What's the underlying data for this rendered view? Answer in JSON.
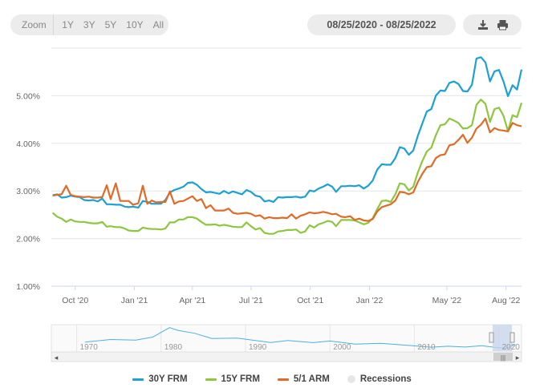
{
  "toolbar": {
    "zoom_label": "Zoom",
    "zoom_options": [
      "1Y",
      "3Y",
      "5Y",
      "10Y",
      "All"
    ],
    "date_range": "08/25/2020 - 08/25/2022",
    "download_icon": "download-icon",
    "print_icon": "print-icon"
  },
  "navigator": {
    "year_labels": [
      "1970",
      "1980",
      "1990",
      "2000",
      "2010",
      "2020"
    ]
  },
  "legend": {
    "items": [
      {
        "label": "30Y FRM",
        "color": "#1ba1d8",
        "type": "line"
      },
      {
        "label": "15Y FRM",
        "color": "#8dc63f",
        "type": "line"
      },
      {
        "label": "5/1 ARM",
        "color": "#e06b27",
        "type": "line"
      },
      {
        "label": "Recessions",
        "color": "#e6e6e6",
        "type": "dot"
      }
    ]
  },
  "chart_data": {
    "type": "line",
    "x_tick_labels": [
      "Oct '20",
      "Jan '21",
      "Apr '21",
      "Jul '21",
      "Oct '21",
      "Jan '22",
      "May '22",
      "Aug '22"
    ],
    "y_tick_labels": [
      "1.00%",
      "2.00%",
      "3.00%",
      "4.00%",
      "5.00%"
    ],
    "ylim": [
      1.0,
      6.0
    ],
    "x": [
      "2020-08-27",
      "2020-09-03",
      "2020-09-10",
      "2020-09-17",
      "2020-09-24",
      "2020-10-01",
      "2020-10-08",
      "2020-10-15",
      "2020-10-22",
      "2020-10-29",
      "2020-11-05",
      "2020-11-12",
      "2020-11-19",
      "2020-11-25",
      "2020-12-03",
      "2020-12-10",
      "2020-12-17",
      "2020-12-23",
      "2020-12-30",
      "2021-01-07",
      "2021-01-14",
      "2021-01-21",
      "2021-01-28",
      "2021-02-04",
      "2021-02-11",
      "2021-02-18",
      "2021-02-25",
      "2021-03-04",
      "2021-03-11",
      "2021-03-18",
      "2021-03-25",
      "2021-04-01",
      "2021-04-08",
      "2021-04-15",
      "2021-04-22",
      "2021-04-29",
      "2021-05-06",
      "2021-05-13",
      "2021-05-20",
      "2021-05-27",
      "2021-06-03",
      "2021-06-10",
      "2021-06-17",
      "2021-06-24",
      "2021-07-01",
      "2021-07-08",
      "2021-07-15",
      "2021-07-22",
      "2021-07-29",
      "2021-08-05",
      "2021-08-12",
      "2021-08-19",
      "2021-08-26",
      "2021-09-02",
      "2021-09-09",
      "2021-09-16",
      "2021-09-23",
      "2021-09-30",
      "2021-10-07",
      "2021-10-14",
      "2021-10-21",
      "2021-10-28",
      "2021-11-04",
      "2021-11-10",
      "2021-11-18",
      "2021-11-24",
      "2021-12-02",
      "2021-12-09",
      "2021-12-16",
      "2021-12-23",
      "2021-12-30",
      "2022-01-06",
      "2022-01-13",
      "2022-01-20",
      "2022-01-27",
      "2022-02-03",
      "2022-02-10",
      "2022-02-17",
      "2022-02-24",
      "2022-03-03",
      "2022-03-10",
      "2022-03-17",
      "2022-03-24",
      "2022-03-31",
      "2022-04-07",
      "2022-04-14",
      "2022-04-21",
      "2022-04-28",
      "2022-05-05",
      "2022-05-12",
      "2022-05-19",
      "2022-05-26",
      "2022-06-02",
      "2022-06-09",
      "2022-06-16",
      "2022-06-23",
      "2022-06-30",
      "2022-07-07",
      "2022-07-14",
      "2022-07-21",
      "2022-07-28",
      "2022-08-04",
      "2022-08-11",
      "2022-08-18",
      "2022-08-25"
    ],
    "series": [
      {
        "name": "30Y FRM",
        "color": "#1ba1d8",
        "values": [
          2.91,
          2.93,
          2.86,
          2.87,
          2.9,
          2.88,
          2.87,
          2.81,
          2.8,
          2.81,
          2.78,
          2.84,
          2.72,
          2.72,
          2.71,
          2.71,
          2.67,
          2.66,
          2.67,
          2.65,
          2.79,
          2.77,
          2.73,
          2.73,
          2.73,
          2.81,
          2.97,
          3.02,
          3.05,
          3.09,
          3.17,
          3.18,
          3.13,
          3.04,
          2.97,
          2.98,
          2.96,
          2.94,
          3.0,
          2.95,
          2.99,
          2.96,
          2.93,
          3.02,
          2.98,
          2.9,
          2.88,
          2.78,
          2.8,
          2.77,
          2.87,
          2.86,
          2.87,
          2.87,
          2.88,
          2.86,
          2.88,
          3.01,
          2.99,
          3.05,
          3.09,
          3.14,
          3.09,
          2.98,
          3.1,
          3.1,
          3.11,
          3.1,
          3.12,
          3.05,
          3.11,
          3.22,
          3.45,
          3.56,
          3.55,
          3.55,
          3.69,
          3.92,
          3.89,
          3.76,
          3.85,
          4.16,
          4.42,
          4.67,
          4.72,
          5.0,
          5.11,
          5.1,
          5.27,
          5.3,
          5.25,
          5.1,
          5.09,
          5.23,
          5.78,
          5.81,
          5.7,
          5.3,
          5.51,
          5.54,
          5.3,
          4.99,
          5.22,
          5.13,
          5.55
        ]
      },
      {
        "name": "15Y FRM",
        "color": "#8dc63f",
        "values": [
          2.54,
          2.46,
          2.42,
          2.35,
          2.4,
          2.36,
          2.35,
          2.35,
          2.33,
          2.32,
          2.32,
          2.35,
          2.25,
          2.26,
          2.24,
          2.24,
          2.21,
          2.17,
          2.16,
          2.16,
          2.23,
          2.21,
          2.2,
          2.2,
          2.19,
          2.21,
          2.34,
          2.34,
          2.4,
          2.4,
          2.45,
          2.45,
          2.42,
          2.35,
          2.29,
          2.29,
          2.3,
          2.27,
          2.29,
          2.27,
          2.25,
          2.24,
          2.24,
          2.34,
          2.26,
          2.19,
          2.22,
          2.12,
          2.1,
          2.1,
          2.15,
          2.16,
          2.18,
          2.18,
          2.19,
          2.12,
          2.15,
          2.28,
          2.23,
          2.3,
          2.33,
          2.37,
          2.35,
          2.26,
          2.39,
          2.39,
          2.39,
          2.38,
          2.34,
          2.3,
          2.33,
          2.43,
          2.62,
          2.79,
          2.8,
          2.77,
          2.93,
          3.16,
          3.14,
          3.01,
          3.09,
          3.39,
          3.63,
          3.83,
          3.91,
          4.17,
          4.38,
          4.4,
          4.52,
          4.48,
          4.43,
          4.31,
          4.32,
          4.38,
          4.81,
          4.92,
          4.83,
          4.45,
          4.72,
          4.75,
          4.58,
          4.26,
          4.59,
          4.55,
          4.85
        ]
      },
      {
        "name": "5/1 ARM",
        "color": "#e06b27",
        "values": [
          2.9,
          2.92,
          2.93,
          3.11,
          2.92,
          2.89,
          2.88,
          2.87,
          2.88,
          2.86,
          2.86,
          2.87,
          3.12,
          2.83,
          3.16,
          2.79,
          2.79,
          2.79,
          2.71,
          2.74,
          3.11,
          2.73,
          2.8,
          2.76,
          2.77,
          2.77,
          2.99,
          2.73,
          2.78,
          2.79,
          2.84,
          2.89,
          2.79,
          2.83,
          2.64,
          2.7,
          2.59,
          2.59,
          2.59,
          2.63,
          2.54,
          2.52,
          2.53,
          2.54,
          2.52,
          2.47,
          2.49,
          2.42,
          2.45,
          2.43,
          2.43,
          2.44,
          2.43,
          2.51,
          2.42,
          2.48,
          2.51,
          2.55,
          2.53,
          2.54,
          2.56,
          2.54,
          2.51,
          2.52,
          2.46,
          2.45,
          2.47,
          2.39,
          2.42,
          2.38,
          2.37,
          2.41,
          2.57,
          2.66,
          2.69,
          2.72,
          2.8,
          2.98,
          2.97,
          2.93,
          2.97,
          3.19,
          3.36,
          3.5,
          3.52,
          3.69,
          3.75,
          3.77,
          3.96,
          3.98,
          4.07,
          4.18,
          4.01,
          4.12,
          4.31,
          4.39,
          4.52,
          4.23,
          4.32,
          4.28,
          4.27,
          4.25,
          4.43,
          4.38,
          4.36
        ]
      }
    ],
    "recession_start": "2020-02-01"
  }
}
